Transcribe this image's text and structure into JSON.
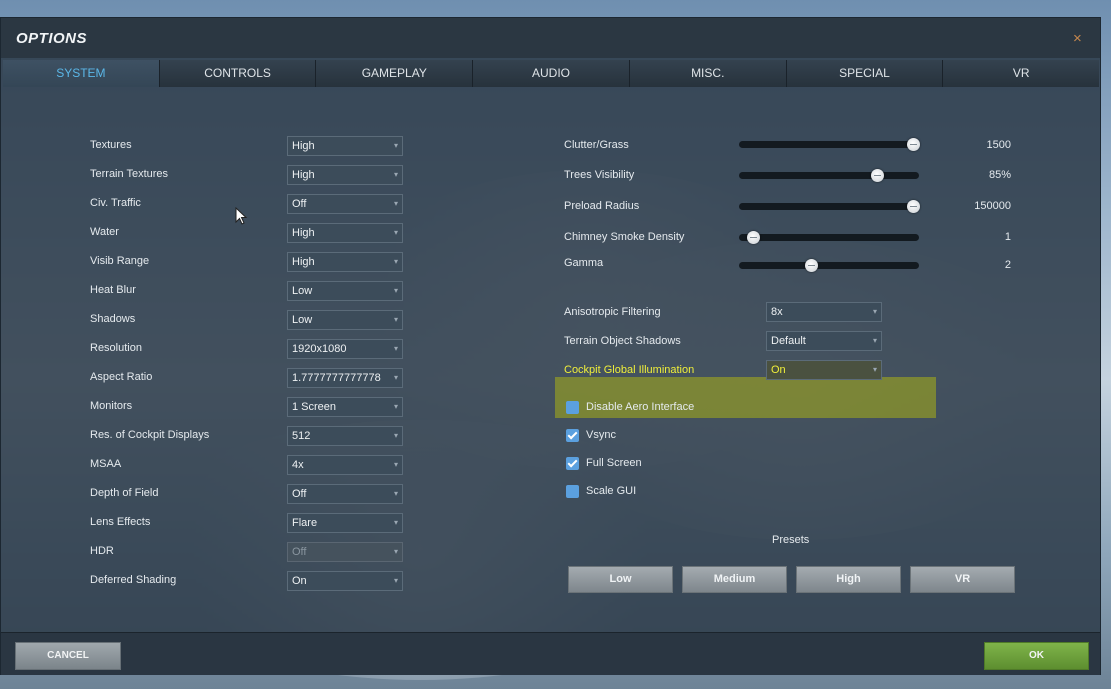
{
  "window": {
    "title": "OPTIONS",
    "close_glyph": "×"
  },
  "tabs": [
    {
      "label": "SYSTEM",
      "active": true
    },
    {
      "label": "CONTROLS"
    },
    {
      "label": "GAMEPLAY"
    },
    {
      "label": "AUDIO"
    },
    {
      "label": "MISC."
    },
    {
      "label": "SPECIAL"
    },
    {
      "label": "VR"
    }
  ],
  "left_settings": [
    {
      "label": "Textures",
      "value": "High"
    },
    {
      "label": "Terrain Textures",
      "value": "High"
    },
    {
      "label": "Civ. Traffic",
      "value": "Off"
    },
    {
      "label": "Water",
      "value": "High"
    },
    {
      "label": "Visib Range",
      "value": "High"
    },
    {
      "label": "Heat Blur",
      "value": "Low"
    },
    {
      "label": "Shadows",
      "value": "Low"
    },
    {
      "label": "Resolution",
      "value": "1920x1080"
    },
    {
      "label": "Aspect Ratio",
      "value": "1.7777777777778"
    },
    {
      "label": "Monitors",
      "value": "1 Screen"
    },
    {
      "label": "Res. of Cockpit Displays",
      "value": "512"
    },
    {
      "label": "MSAA",
      "value": "4x"
    },
    {
      "label": "Depth of Field",
      "value": "Off"
    },
    {
      "label": "Lens Effects",
      "value": "Flare"
    },
    {
      "label": "HDR",
      "value": "Off",
      "disabled": true
    },
    {
      "label": "Deferred Shading",
      "value": "On"
    }
  ],
  "sliders": [
    {
      "label": "Clutter/Grass",
      "value": "1500",
      "fraction": 0.97
    },
    {
      "label": "Trees Visibility",
      "value": "85%",
      "fraction": 0.77
    },
    {
      "label": "Preload Radius",
      "value": "150000",
      "fraction": 0.97
    },
    {
      "label": "Chimney Smoke Density",
      "value": "1",
      "fraction": 0.08
    },
    {
      "label": "Gamma",
      "value": "2",
      "fraction": 0.4
    }
  ],
  "right_dropdowns": [
    {
      "label": "Anisotropic Filtering",
      "value": "8x"
    },
    {
      "label": "Terrain Object Shadows",
      "value": "Default"
    },
    {
      "label": "Cockpit Global Illumination",
      "value": "On",
      "highlighted": true
    }
  ],
  "checkboxes": [
    {
      "label": "Disable Aero Interface",
      "checked": false
    },
    {
      "label": "Vsync",
      "checked": true
    },
    {
      "label": "Full Screen",
      "checked": true
    },
    {
      "label": "Scale GUI",
      "checked": false
    }
  ],
  "presets": {
    "title": "Presets",
    "buttons": [
      "Low",
      "Medium",
      "High",
      "VR"
    ]
  },
  "footer": {
    "cancel_label": "CANCEL",
    "ok_label": "OK"
  },
  "colors": {
    "active_tab": "#5bb7e8",
    "highlight": "#c8cd00",
    "highlight_text": "#f0ef3a",
    "ok_green": "#6fa23c",
    "close": "#c7884e"
  }
}
